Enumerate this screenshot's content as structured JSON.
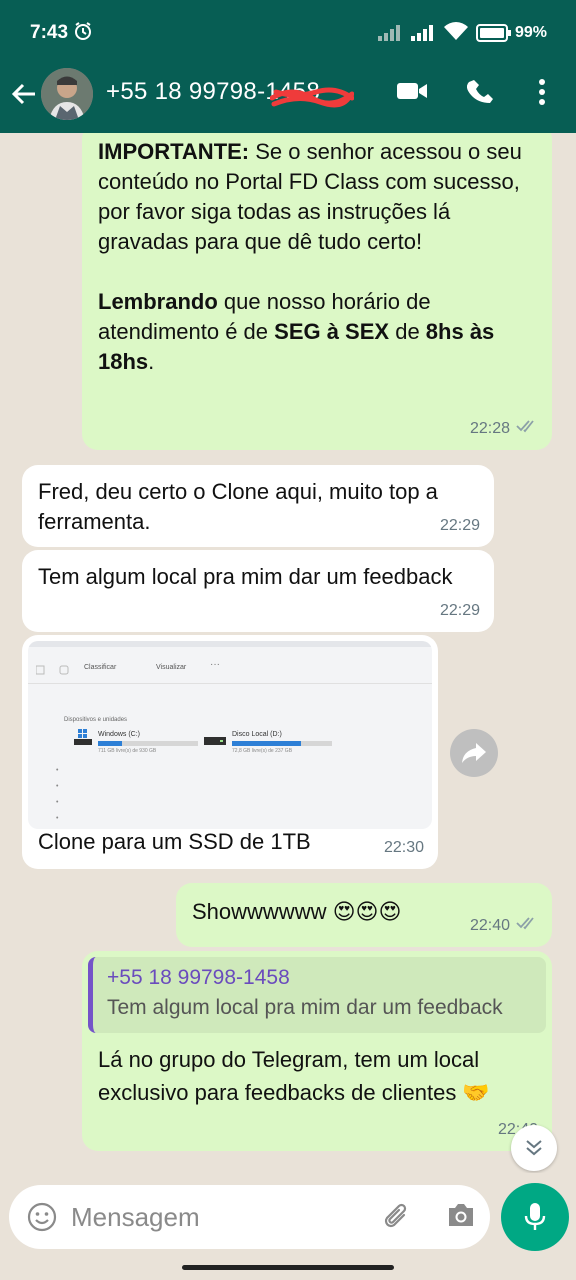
{
  "status": {
    "time": "7:43",
    "battery": "99%"
  },
  "header": {
    "contact": "+55 18 99798-1458"
  },
  "messages": {
    "m1": {
      "p1_bold": "IMPORTANTE:",
      "p1_text": " Se o senhor acessou o seu conteúdo no Portal FD Class com sucesso, por favor siga todas as instruções lá gravadas para que dê tudo certo!",
      "p2_bold1": "Lembrando",
      "p2_t1": " que nosso horário de atendimento é de ",
      "p2_bold2": "SEG à SEX",
      "p2_t2": " de ",
      "p2_bold3": "8hs às 18hs",
      "p2_t3": ".",
      "time": "22:28"
    },
    "m2": {
      "text": "Fred, deu certo o Clone aqui, muito top a ferramenta.",
      "time": "22:29"
    },
    "m3": {
      "text": "Tem algum local pra mim dar um feedback",
      "time": "22:29"
    },
    "m4": {
      "caption": "Clone para um SSD de 1TB",
      "time": "22:30",
      "screenshot": {
        "toolbar_sort": "Classificar",
        "toolbar_view": "Visualizar",
        "section": "Dispositivos e unidades",
        "drive1_name": "Windows (C:)",
        "drive1_space": "711 GB livre(s) de 930 GB",
        "drive1_fill": 0.24,
        "drive2_name": "Disco Local (D:)",
        "drive2_space": "72,8 GB livre(s) de 237 GB",
        "drive2_fill": 0.69
      }
    },
    "m5": {
      "text": "Showwwwww 😍😍😍",
      "time": "22:40"
    },
    "m6": {
      "quote_name": "+55 18 99798-1458",
      "quote_text": "Tem algum local pra mim dar um feedback",
      "text": "Lá no grupo do Telegram, tem um local exclusivo para feedbacks de clientes 🤝",
      "time": "22:40"
    }
  },
  "composer": {
    "placeholder": "Mensagem"
  },
  "colors": {
    "header": "#075e54",
    "outgoing": "#dcf8c6",
    "incoming": "#ffffff",
    "mic": "#00a884",
    "quote_bar": "#7454c8"
  }
}
